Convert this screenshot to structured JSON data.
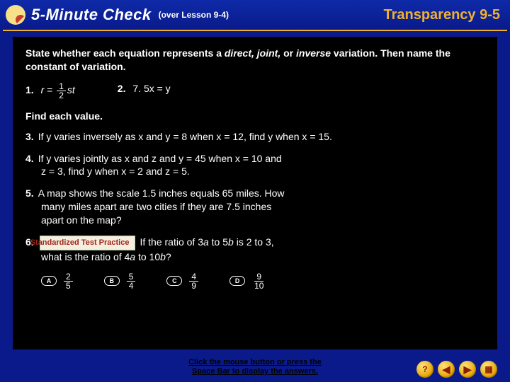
{
  "header": {
    "title": "5-Minute Check",
    "over": "(over Lesson 9-4)",
    "transparency": "Transparency 9-5"
  },
  "instructions": {
    "line": "State whether each equation represents a ",
    "words": "direct, joint, ",
    "or": "or ",
    "inverse": "inverse",
    "tail": " variation. Then name the constant of variation."
  },
  "q1": {
    "num": "1.",
    "lead": "r",
    "eq": " = ",
    "n": "1",
    "d": "2",
    "tail": "st"
  },
  "q2": {
    "num": "2.",
    "body": "7. 5x  =  y"
  },
  "section2": "Find each value.",
  "q3": {
    "num": "3.",
    "body": "If y varies inversely as x and y  =  8 when x  =  12, find y when x = 15."
  },
  "q4": {
    "num": "4.",
    "l1": "If y varies jointly as x and z and y  =  45 when x  =  10 and",
    "l2": "z  =  3, find y when x  =  2 and z = 5."
  },
  "q5": {
    "num": "5.",
    "l1": "A map shows the scale 1.5 inches equals 65 miles. How",
    "l2": "many miles apart are two cities if they are 7.5 inches",
    "l3": "apart on the map?"
  },
  "q6": {
    "num": "6.",
    "badge": "Standardized Test Practice",
    "l1a": "If the ratio of 3",
    "l1b": "a",
    "l1c": " to 5",
    "l1d": "b",
    "l1e": " is 2 to 3,",
    "l2a": "what is the ratio of 4",
    "l2b": "a",
    "l2c": " to 10",
    "l2d": "b",
    "l2e": "?"
  },
  "choices": {
    "A": {
      "letter": "A",
      "n": "2",
      "d": "5"
    },
    "B": {
      "letter": "B",
      "n": "5",
      "d": "4"
    },
    "C": {
      "letter": "C",
      "n": "4",
      "d": "9"
    },
    "D": {
      "letter": "D",
      "n": "9",
      "d": "10"
    }
  },
  "footer": {
    "hint1": "Click the mouse button or press the",
    "hint2": "Space Bar to display the answers."
  },
  "nav": {
    "help": "?",
    "back": "◀",
    "fwd": "▶",
    "menu": "▦"
  }
}
